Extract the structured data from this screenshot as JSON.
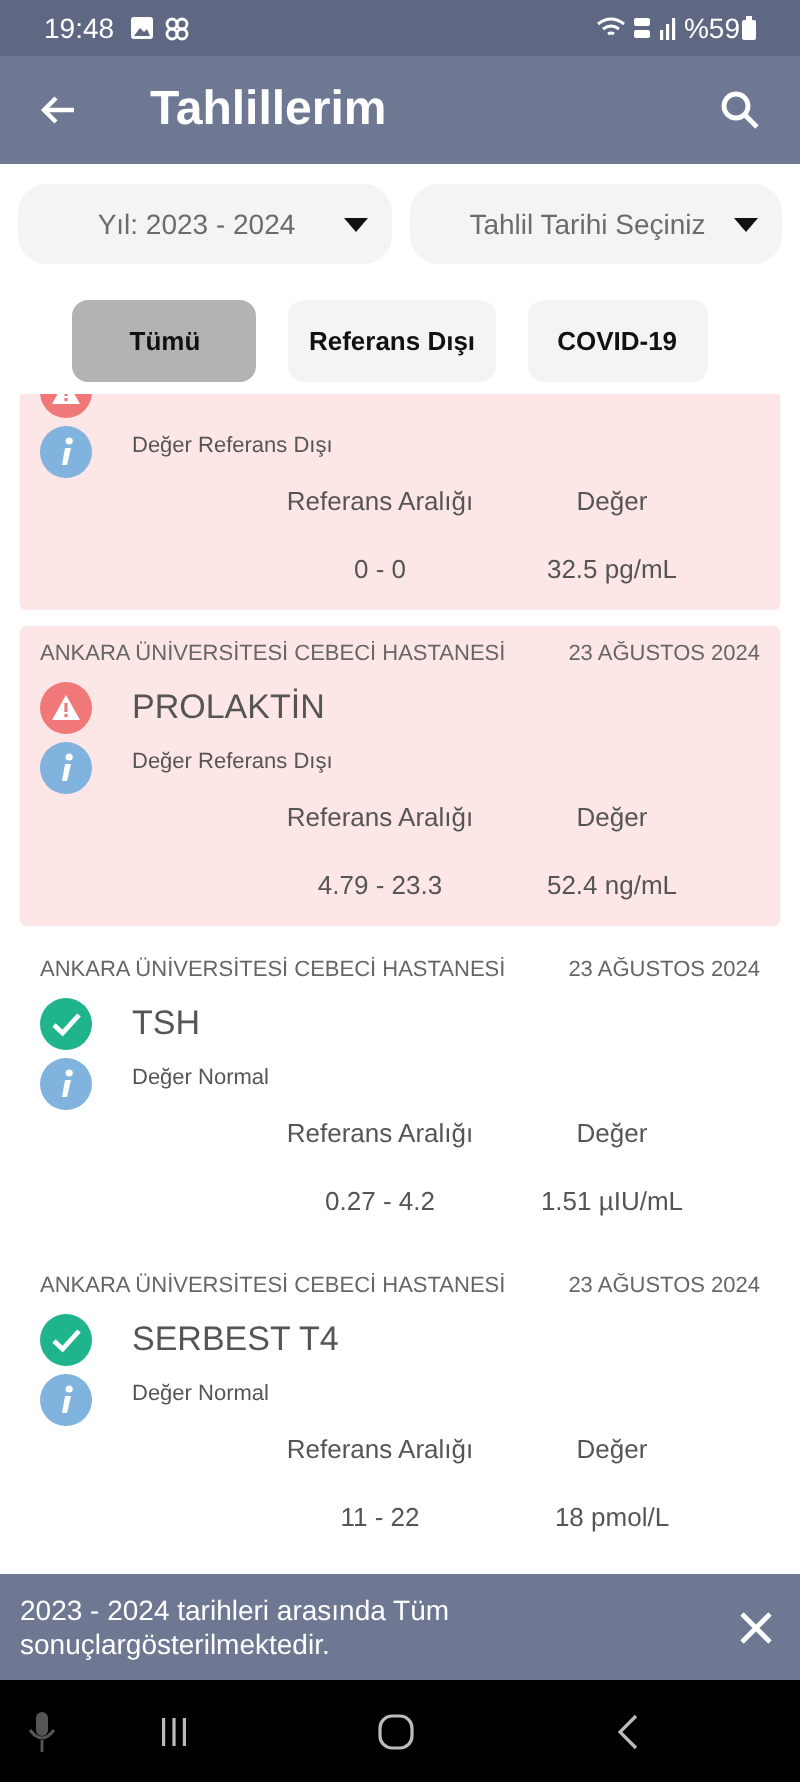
{
  "status_bar": {
    "time": "19:48",
    "battery": "%59"
  },
  "app_bar": {
    "title": "Tahlillerim"
  },
  "filters": [
    {
      "value": "Yıl: 2023 - 2024"
    },
    {
      "value": "Tahlil Tarihi Seçiniz"
    }
  ],
  "tabs": [
    {
      "label": "Tümü",
      "selected": true
    },
    {
      "label": "Referans Dışı",
      "selected": false
    },
    {
      "label": "COVID-19",
      "selected": false
    }
  ],
  "results": [
    {
      "out_of_range": true,
      "note": "Değer Referans Dışı",
      "range_label": "Referans Aralığı",
      "value_label": "Değer",
      "range": "0 - 0",
      "value": "32.5 pg/mL"
    },
    {
      "hospital": "ANKARA ÜNİVERSİTESİ CEBECİ HASTANESİ",
      "date": "23 AĞUSTOS 2024",
      "name": "PROLAKTİN",
      "out_of_range": true,
      "note": "Değer Referans Dışı",
      "range_label": "Referans Aralığı",
      "value_label": "Değer",
      "range": "4.79 - 23.3",
      "value": "52.4 ng/mL"
    },
    {
      "hospital": "ANKARA ÜNİVERSİTESİ CEBECİ HASTANESİ",
      "date": "23 AĞUSTOS 2024",
      "name": "TSH",
      "out_of_range": false,
      "note": "Değer Normal",
      "range_label": "Referans Aralığı",
      "value_label": "Değer",
      "range": "0.27 - 4.2",
      "value": "1.51 µIU/mL"
    },
    {
      "hospital": "ANKARA ÜNİVERSİTESİ CEBECİ HASTANESİ",
      "date": "23 AĞUSTOS 2024",
      "name": "SERBEST T4",
      "out_of_range": false,
      "note": "Değer Normal",
      "range_label": "Referans Aralığı",
      "value_label": "Değer",
      "range": "11 - 22",
      "value": "18 pmol/L"
    }
  ],
  "snackbar": {
    "message": "2023 - 2024 tarihleri arasında Tüm sonuçlargösterilmektedir."
  }
}
